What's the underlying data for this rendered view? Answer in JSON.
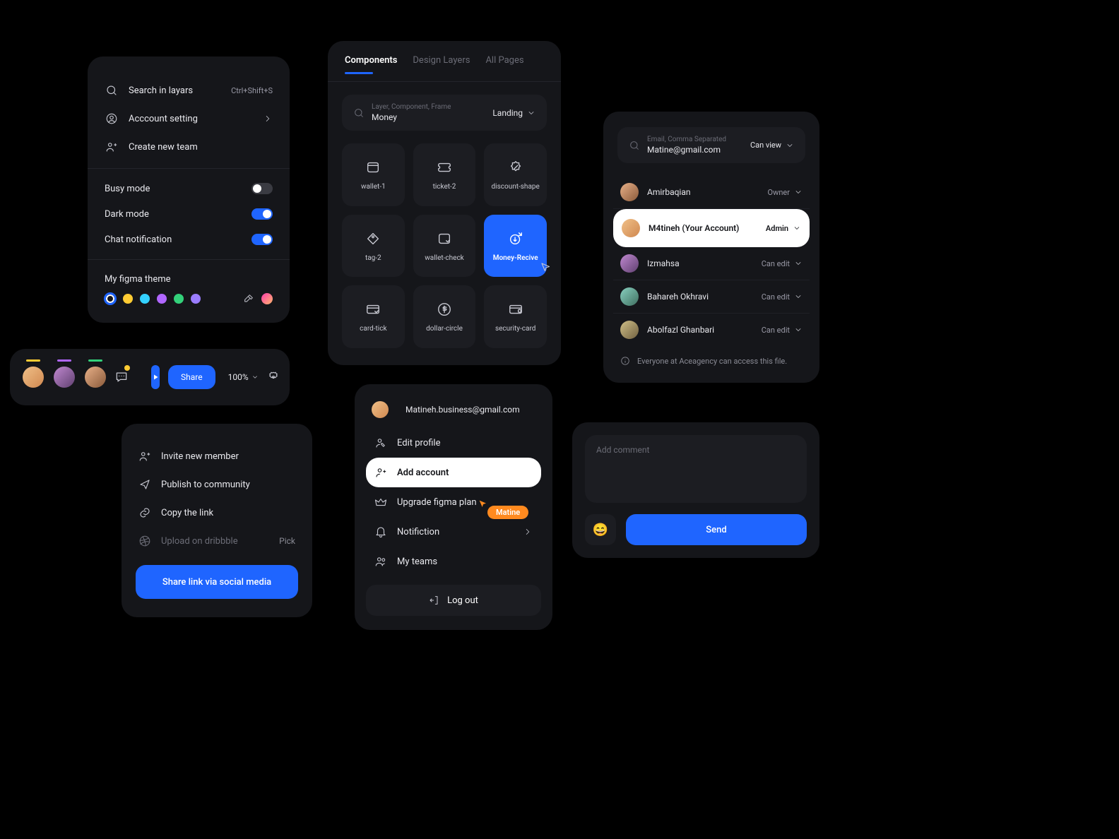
{
  "settings": {
    "search_label": "Search in layars",
    "search_shortcut": "Ctrl+Shift+S",
    "account_label": "Acccount setting",
    "create_team_label": "Create new team",
    "busy_mode": "Busy mode",
    "dark_mode": "Dark mode",
    "chat_notif": "Chat notification",
    "theme_title": "My figma theme",
    "theme_colors": [
      "#1f65ff",
      "#ffcc33",
      "#33d1ff",
      "#b066ff",
      "#33d17a",
      "#9a7dff"
    ]
  },
  "components": {
    "tabs": [
      "Components",
      "Design Layers",
      "All Pages"
    ],
    "active_tab": 0,
    "search_placeholder": "Layer, Component, Frame",
    "search_value": "Money",
    "scope": "Landing",
    "tiles": [
      {
        "label": "wallet-1"
      },
      {
        "label": "ticket-2"
      },
      {
        "label": "discount-shape"
      },
      {
        "label": "tag-2"
      },
      {
        "label": "wallet-check"
      },
      {
        "label": "Money-Recive",
        "active": true
      },
      {
        "label": "card-tick"
      },
      {
        "label": "dollar-circle"
      },
      {
        "label": "security-card"
      }
    ]
  },
  "perms": {
    "email_placeholder": "Email, Comma Separated",
    "email_value": "Matine@gmail.com",
    "default_role": "Can view",
    "members": [
      {
        "name": "Amirbaqian",
        "role": "Owner",
        "hue": 20
      },
      {
        "name": "M4tineh (Your Account)",
        "role": "Admin",
        "active": true,
        "hue": 35
      },
      {
        "name": "Izmahsa",
        "role": "Can edit",
        "hue": 300
      },
      {
        "name": "Bahareh Okhravi",
        "role": "Can edit",
        "hue": 180
      },
      {
        "name": "Abolfazl Ghanbari",
        "role": "Can edit",
        "hue": 45
      }
    ],
    "info": "Everyone at Aceagency can access this file."
  },
  "collab": {
    "bars": [
      "#ffcc33",
      "#b066ff",
      "#33d17a"
    ],
    "share_label": "Share",
    "zoom": "100%"
  },
  "shareopts": {
    "invite": "Invite new member",
    "publish": "Publish to community",
    "copy": "Copy the link",
    "dribbble": "Upload on dribbble",
    "dribbble_rt": "Pick",
    "cta": "Share link via social media"
  },
  "acct": {
    "email": "Matineh.business@gmail.com",
    "edit": "Edit profile",
    "add": "Add account",
    "upgrade": "Upgrade figma plan",
    "notif": "Notifiction",
    "teams": "My teams",
    "logout": "Log out",
    "cursor_label": "Matine"
  },
  "comment": {
    "placeholder": "Add comment",
    "send": "Send",
    "emoji": "😄"
  }
}
